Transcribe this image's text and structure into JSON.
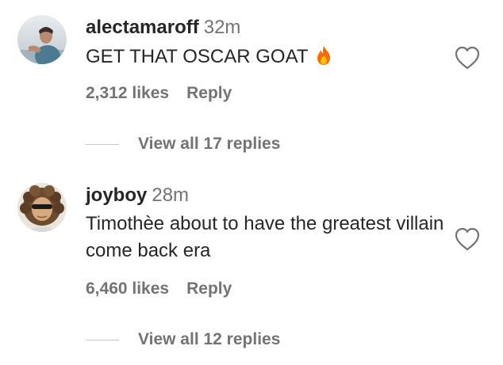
{
  "comments": [
    {
      "username": "alectamaroff",
      "time": "32m",
      "text": "GET THAT OSCAR GOAT",
      "emoji": "fire-emoji",
      "likes": "2,312 likes",
      "reply_label": "Reply",
      "view_replies": "View all 17 replies",
      "avatar_icon": "profile-photo"
    },
    {
      "username": "joyboy",
      "time": "28m",
      "text": "Timothèe about to have the greatest villain come back era",
      "likes": "6,460 likes",
      "reply_label": "Reply",
      "view_replies": "View all 12 replies",
      "avatar_icon": "profile-photo"
    }
  ],
  "icons": {
    "like": "heart-outline-icon"
  },
  "colors": {
    "primary_text": "#262626",
    "secondary_text": "#737373",
    "divider": "#c7c7c7",
    "fire": "#ff6a00"
  }
}
